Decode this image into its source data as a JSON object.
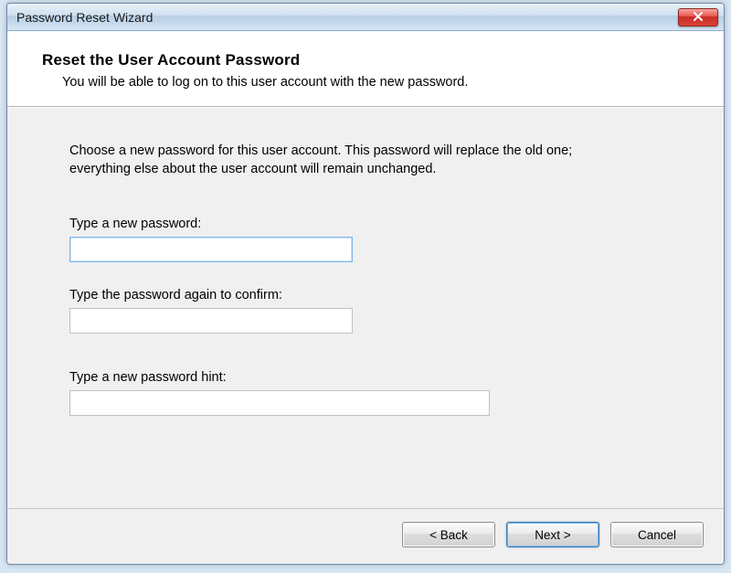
{
  "titlebar": {
    "title": "Password Reset Wizard"
  },
  "header": {
    "heading": "Reset the User Account Password",
    "subheading": "You will be able to log on to this user account with the new password."
  },
  "body": {
    "instruction": "Choose a new password for this user account. This password will replace the old one; everything else about the user account will remain unchanged.",
    "fields": {
      "new_password": {
        "label": "Type a new password:",
        "value": ""
      },
      "confirm_password": {
        "label": "Type the password again to confirm:",
        "value": ""
      },
      "hint": {
        "label": "Type a new password hint:",
        "value": ""
      }
    }
  },
  "footer": {
    "back_label": "< Back",
    "next_label": "Next >",
    "cancel_label": "Cancel"
  }
}
